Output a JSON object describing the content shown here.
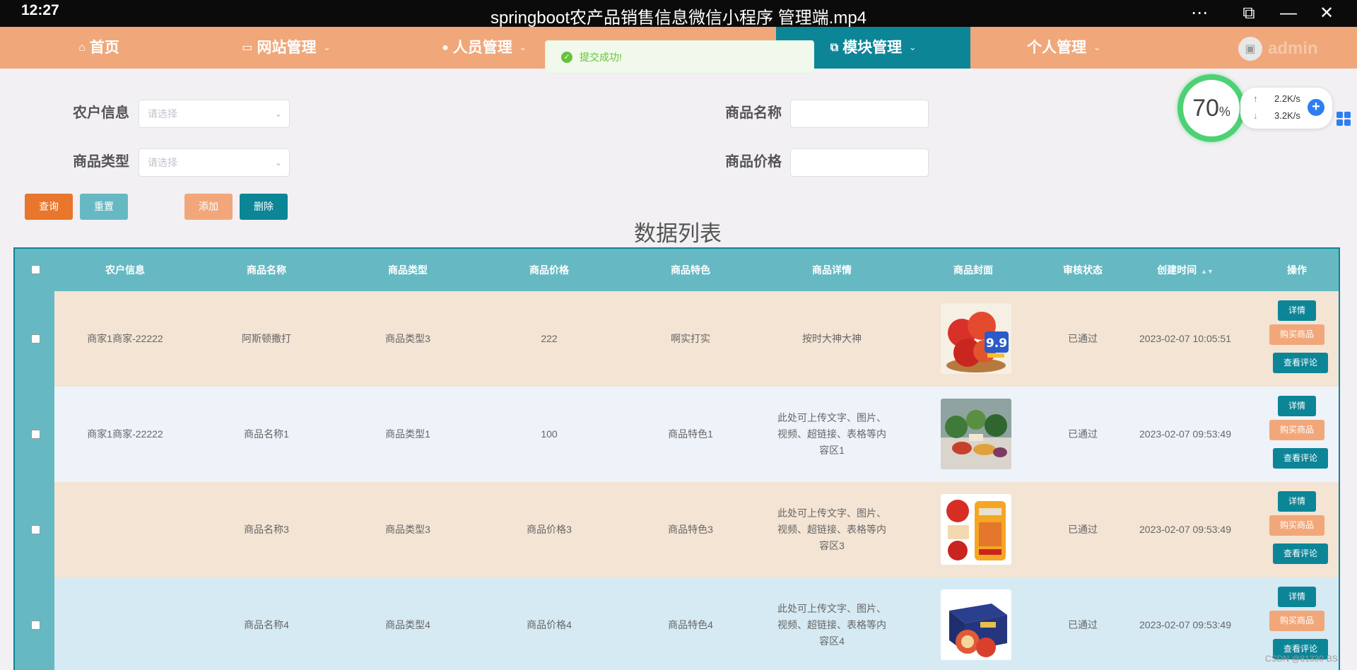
{
  "player": {
    "time": "12:27",
    "title": "springboot农产品销售信息微信小程序 管理端.mp4",
    "more_icon": "⋯",
    "pip_icon": "⧉",
    "minimize_icon": "—",
    "close_icon": "✕"
  },
  "nav": {
    "items": [
      {
        "label": "首页",
        "icon": "⌂",
        "caret": ""
      },
      {
        "label": "网站管理",
        "icon": "▭",
        "caret": "⌄"
      },
      {
        "label": "人员管理",
        "icon": "●",
        "caret": "⌄"
      },
      {
        "label": "模块管理",
        "icon": "⧉",
        "caret": "⌄"
      },
      {
        "label": "个人管理",
        "icon": "",
        "caret": "⌄"
      }
    ],
    "user": "admin",
    "active_color": "#0c8597",
    "bar_color": "#f0a77a"
  },
  "toast": {
    "text": "提交成功!",
    "icon": "✓"
  },
  "search": {
    "farmer_label": "农户信息",
    "farmer_placeholder": "请选择",
    "type_label": "商品类型",
    "type_placeholder": "请选择",
    "name_label": "商品名称",
    "name_value": "",
    "price_label": "商品价格",
    "price_value": "",
    "chevron_icon": "⌄"
  },
  "buttons": {
    "query": "查询",
    "reset": "重置",
    "add": "添加",
    "delete": "删除"
  },
  "list_title": "数据列表",
  "table": {
    "headers": [
      "农户信息",
      "商品名称",
      "商品类型",
      "商品价格",
      "商品特色",
      "商品详情",
      "商品封面",
      "审核状态",
      "创建时间",
      "操作"
    ],
    "sort_icon": "▲▼",
    "rows": [
      {
        "farmer": "商家1商家-22222",
        "name": "阿斯顿撒打",
        "type": "商品类型3",
        "price": "222",
        "feature": "啊实打实",
        "detail": "按时大神大神",
        "cover": "apples-9.9",
        "status": "已通过",
        "created": "2023-02-07 10:05:51",
        "bg": "#f3e4d4"
      },
      {
        "farmer": "商家1商家-22222",
        "name": "商品名称1",
        "type": "商品类型1",
        "price": "100",
        "feature": "商品特色1",
        "detail": "此处可上传文字、图片、视频、超链接、表格等内容区1",
        "cover": "vegetables",
        "status": "已通过",
        "created": "2023-02-07 09:53:49",
        "bg": "#eef3fa"
      },
      {
        "farmer": "",
        "name": "商品名称3",
        "type": "商品类型3",
        "price": "商品价格3",
        "feature": "商品特色3",
        "detail": "此处可上传文字、图片、视频、超链接、表格等内容区3",
        "cover": "rice-bag",
        "status": "已通过",
        "created": "2023-02-07 09:53:49",
        "bg": "#f3e4d4"
      },
      {
        "farmer": "",
        "name": "商品名称4",
        "type": "商品类型4",
        "price": "商品价格4",
        "feature": "商品特色4",
        "detail": "此处可上传文字、图片、视频、超链接、表格等内容区4",
        "cover": "apple-box",
        "status": "已通过",
        "created": "2023-02-07 09:53:49",
        "bg": "#d6eaf3"
      }
    ],
    "op_buttons": {
      "detail": "详情",
      "buy": "购买商品",
      "comments": "查看评论"
    }
  },
  "overlay": {
    "gauge_value": "70",
    "gauge_unit": "%",
    "upload": "2.2K/s",
    "download": "3.2K/s",
    "up_icon": "↑",
    "down_icon": "↓",
    "plus_icon": "+"
  },
  "watermark": "CSDN @81330-BS"
}
